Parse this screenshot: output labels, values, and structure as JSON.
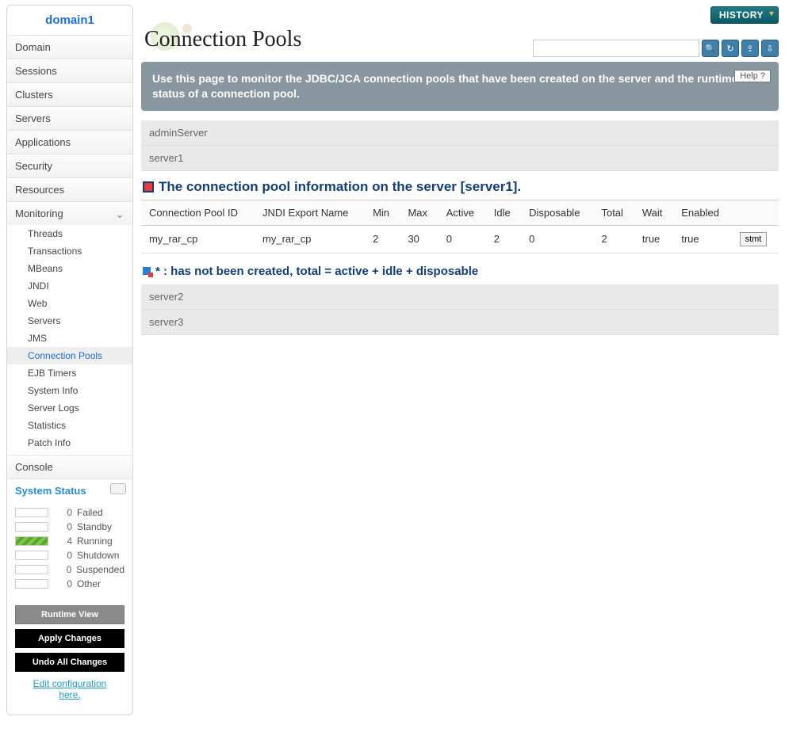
{
  "sidebar": {
    "title": "domain1",
    "items": [
      {
        "label": "Domain"
      },
      {
        "label": "Sessions"
      },
      {
        "label": "Clusters"
      },
      {
        "label": "Servers"
      },
      {
        "label": "Applications"
      },
      {
        "label": "Security"
      },
      {
        "label": "Resources"
      },
      {
        "label": "Monitoring",
        "expandable": true
      }
    ],
    "monitoring_sub": [
      {
        "label": "Threads"
      },
      {
        "label": "Transactions"
      },
      {
        "label": "MBeans"
      },
      {
        "label": "JNDI"
      },
      {
        "label": "Web"
      },
      {
        "label": "Servers"
      },
      {
        "label": "JMS"
      },
      {
        "label": "Connection Pools",
        "active": true
      },
      {
        "label": "EJB Timers"
      },
      {
        "label": "System Info"
      },
      {
        "label": "Server Logs"
      },
      {
        "label": "Statistics"
      },
      {
        "label": "Patch Info"
      }
    ],
    "console_label": "Console",
    "system_status_label": "System Status",
    "status": [
      {
        "count": "0",
        "label": "Failed"
      },
      {
        "count": "0",
        "label": "Standby"
      },
      {
        "count": "4",
        "label": "Running",
        "running": true
      },
      {
        "count": "0",
        "label": "Shutdown"
      },
      {
        "count": "0",
        "label": "Suspended"
      },
      {
        "count": "0",
        "label": "Other"
      }
    ],
    "btn_runtime": "Runtime View",
    "btn_apply": "Apply Changes",
    "btn_undo": "Undo All Changes",
    "edit_link": "Edit configuration here."
  },
  "main": {
    "history_label": "HISTORY",
    "title": "Connection Pools",
    "info_text": "Use this page to monitor the JDBC/JCA connection pools that have been created on the server and the runtime status of a connection pool.",
    "help_label": "Help",
    "servers_above": [
      "adminServer",
      "server1"
    ],
    "section_title": "The connection pool information on the server [server1].",
    "table": {
      "columns": [
        "Connection Pool ID",
        "JNDI Export Name",
        "Min",
        "Max",
        "Active",
        "Idle",
        "Disposable",
        "Total",
        "Wait",
        "Enabled",
        ""
      ],
      "rows": [
        {
          "id": "my_rar_cp",
          "jndi": "my_rar_cp",
          "min": "2",
          "max": "30",
          "active": "0",
          "idle": "2",
          "disposable": "0",
          "total": "2",
          "wait": "true",
          "enabled": "true",
          "action": "stmt"
        }
      ]
    },
    "note_text": "* : has not been created, total = active + idle + disposable",
    "servers_below": [
      "server2",
      "server3"
    ]
  }
}
